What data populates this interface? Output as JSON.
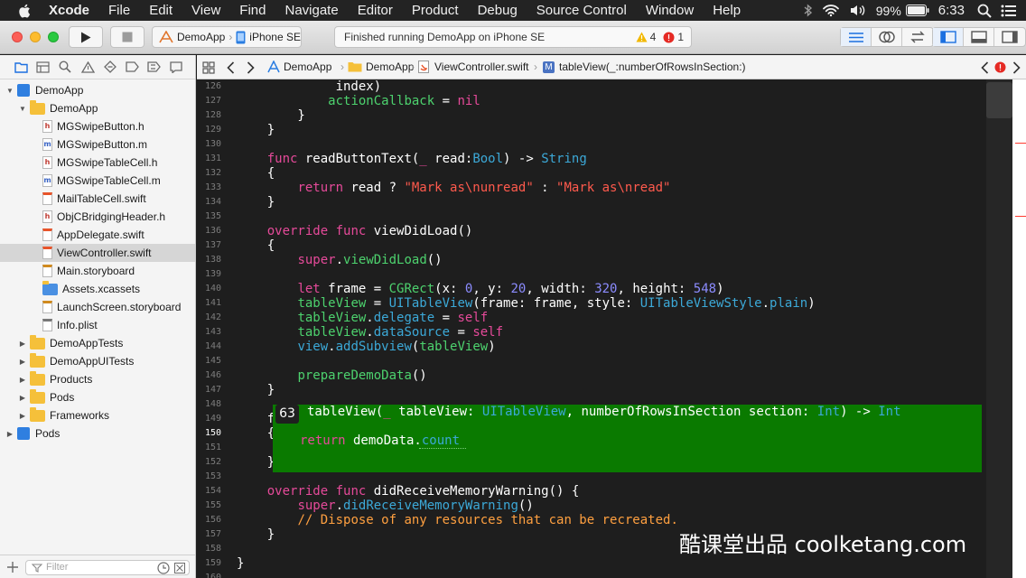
{
  "menubar": {
    "app": "Xcode",
    "items": [
      "File",
      "Edit",
      "View",
      "Find",
      "Navigate",
      "Editor",
      "Product",
      "Debug",
      "Source Control",
      "Window",
      "Help"
    ],
    "battery": "99%",
    "time": "6:33"
  },
  "toolbar": {
    "scheme": "DemoApp",
    "device": "iPhone SE",
    "status": "Finished running DemoApp on iPhone SE",
    "warnings": "4",
    "errors": "1"
  },
  "navigator": {
    "tree": [
      {
        "label": "DemoApp",
        "kind": "project",
        "level": 0,
        "open": true
      },
      {
        "label": "DemoApp",
        "kind": "folder",
        "level": 1,
        "open": true
      },
      {
        "label": "MGSwipeButton.h",
        "kind": "h",
        "level": 2
      },
      {
        "label": "MGSwipeButton.m",
        "kind": "m",
        "level": 2
      },
      {
        "label": "MGSwipeTableCell.h",
        "kind": "h",
        "level": 2
      },
      {
        "label": "MGSwipeTableCell.m",
        "kind": "m",
        "level": 2
      },
      {
        "label": "MailTableCell.swift",
        "kind": "swift",
        "level": 2
      },
      {
        "label": "ObjCBridgingHeader.h",
        "kind": "h",
        "level": 2
      },
      {
        "label": "AppDelegate.swift",
        "kind": "swift",
        "level": 2
      },
      {
        "label": "ViewController.swift",
        "kind": "swift",
        "level": 2,
        "selected": true
      },
      {
        "label": "Main.storyboard",
        "kind": "storyboard",
        "level": 2
      },
      {
        "label": "Assets.xcassets",
        "kind": "assets",
        "level": 2
      },
      {
        "label": "LaunchScreen.storyboard",
        "kind": "storyboard",
        "level": 2
      },
      {
        "label": "Info.plist",
        "kind": "plist",
        "level": 2
      },
      {
        "label": "DemoAppTests",
        "kind": "folder",
        "level": 1,
        "open": false
      },
      {
        "label": "DemoAppUITests",
        "kind": "folder",
        "level": 1,
        "open": false
      },
      {
        "label": "Products",
        "kind": "folder",
        "level": 1,
        "open": false
      },
      {
        "label": "Pods",
        "kind": "folder",
        "level": 1,
        "open": false
      },
      {
        "label": "Frameworks",
        "kind": "folder",
        "level": 1,
        "open": false
      },
      {
        "label": "Pods",
        "kind": "project",
        "level": 0,
        "open": false
      }
    ],
    "filter_placeholder": "Filter"
  },
  "jumpbar": {
    "crumbs": [
      "DemoApp",
      "DemoApp",
      "ViewController.swift",
      "tableView(_:numberOfRowsInSection:)"
    ]
  },
  "editor": {
    "current_line": "150",
    "lines": [
      {
        "n": "126",
        "t": [
          [
            "",
            "             index)"
          ]
        ]
      },
      {
        "n": "127",
        "t": [
          [
            "",
            "            "
          ],
          [
            "fn",
            "actionCallback"
          ],
          [
            "",
            " = "
          ],
          [
            "kw",
            "nil"
          ]
        ]
      },
      {
        "n": "128",
        "t": [
          [
            "",
            "        }"
          ]
        ]
      },
      {
        "n": "129",
        "t": [
          [
            "",
            "    }"
          ]
        ]
      },
      {
        "n": "130",
        "t": [
          [
            "",
            ""
          ]
        ]
      },
      {
        "n": "131",
        "t": [
          [
            "",
            "    "
          ],
          [
            "kw",
            "func"
          ],
          [
            "",
            " readButtonText("
          ],
          [
            "kw",
            "_"
          ],
          [
            "",
            " read:"
          ],
          [
            "ty",
            "Bool"
          ],
          [
            "",
            ") -> "
          ],
          [
            "ty",
            "String"
          ]
        ]
      },
      {
        "n": "132",
        "t": [
          [
            "",
            "    {"
          ]
        ]
      },
      {
        "n": "133",
        "t": [
          [
            "",
            "        "
          ],
          [
            "kw",
            "return"
          ],
          [
            "",
            " read ? "
          ],
          [
            "st",
            "\"Mark as\\nunread\""
          ],
          [
            "",
            " : "
          ],
          [
            "st",
            "\"Mark as\\nread\""
          ]
        ]
      },
      {
        "n": "134",
        "t": [
          [
            "",
            "    }"
          ]
        ]
      },
      {
        "n": "135",
        "t": [
          [
            "",
            ""
          ]
        ]
      },
      {
        "n": "136",
        "t": [
          [
            "",
            "    "
          ],
          [
            "kw",
            "override"
          ],
          [
            "",
            " "
          ],
          [
            "kw",
            "func"
          ],
          [
            "",
            " viewDidLoad()"
          ]
        ]
      },
      {
        "n": "137",
        "t": [
          [
            "",
            "    {"
          ]
        ]
      },
      {
        "n": "138",
        "t": [
          [
            "",
            "        "
          ],
          [
            "kw",
            "super"
          ],
          [
            "",
            "."
          ],
          [
            "fn",
            "viewDidLoad"
          ],
          [
            "",
            "()"
          ]
        ]
      },
      {
        "n": "139",
        "t": [
          [
            "",
            ""
          ]
        ]
      },
      {
        "n": "140",
        "t": [
          [
            "",
            "        "
          ],
          [
            "kw",
            "let"
          ],
          [
            "",
            " frame = "
          ],
          [
            "fn",
            "CGRect"
          ],
          [
            "",
            "(x: "
          ],
          [
            "nm",
            "0"
          ],
          [
            "",
            ", y: "
          ],
          [
            "nm",
            "20"
          ],
          [
            "",
            ", width: "
          ],
          [
            "nm",
            "320"
          ],
          [
            "",
            ", height: "
          ],
          [
            "nm",
            "548"
          ],
          [
            "",
            ")"
          ]
        ]
      },
      {
        "n": "141",
        "t": [
          [
            "",
            "        "
          ],
          [
            "fn",
            "tableView"
          ],
          [
            "",
            " = "
          ],
          [
            "ty",
            "UITableView"
          ],
          [
            "",
            "(frame: frame, style: "
          ],
          [
            "ty",
            "UITableViewStyle"
          ],
          [
            "",
            "."
          ],
          [
            "ty",
            "plain"
          ],
          [
            "",
            ")"
          ]
        ]
      },
      {
        "n": "142",
        "t": [
          [
            "",
            "        "
          ],
          [
            "fn",
            "tableView"
          ],
          [
            "",
            "."
          ],
          [
            "ty",
            "delegate"
          ],
          [
            "",
            " = "
          ],
          [
            "kw",
            "self"
          ]
        ]
      },
      {
        "n": "143",
        "t": [
          [
            "",
            "        "
          ],
          [
            "fn",
            "tableView"
          ],
          [
            "",
            "."
          ],
          [
            "ty",
            "dataSource"
          ],
          [
            "",
            " = "
          ],
          [
            "kw",
            "self"
          ]
        ]
      },
      {
        "n": "144",
        "t": [
          [
            "",
            "        "
          ],
          [
            "ty",
            "view"
          ],
          [
            "",
            "."
          ],
          [
            "ty",
            "addSubview"
          ],
          [
            "",
            "("
          ],
          [
            "fn",
            "tableView"
          ],
          [
            "",
            ")"
          ]
        ]
      },
      {
        "n": "145",
        "t": [
          [
            "",
            ""
          ]
        ]
      },
      {
        "n": "146",
        "t": [
          [
            "",
            "        "
          ],
          [
            "fn",
            "prepareDemoData"
          ],
          [
            "",
            "()"
          ]
        ]
      },
      {
        "n": "147",
        "t": [
          [
            "",
            "    }"
          ]
        ]
      },
      {
        "n": "148",
        "t": [
          [
            "",
            ""
          ]
        ]
      },
      {
        "n": "149",
        "t": [
          [
            "",
            "    f"
          ]
        ]
      },
      {
        "n": "150",
        "t": [
          [
            "",
            "    {"
          ]
        ]
      },
      {
        "n": "151",
        "t": [
          [
            "",
            ""
          ]
        ]
      },
      {
        "n": "152",
        "t": [
          [
            "",
            "    }"
          ]
        ]
      },
      {
        "n": "153",
        "t": [
          [
            "",
            ""
          ]
        ]
      },
      {
        "n": "154",
        "t": [
          [
            "",
            "    "
          ],
          [
            "kw",
            "override"
          ],
          [
            "",
            " "
          ],
          [
            "kw",
            "func"
          ],
          [
            "",
            " didReceiveMemoryWarning() {"
          ]
        ]
      },
      {
        "n": "155",
        "t": [
          [
            "",
            "        "
          ],
          [
            "kw",
            "super"
          ],
          [
            "",
            "."
          ],
          [
            "ty",
            "didReceiveMemoryWarning"
          ],
          [
            "",
            "()"
          ]
        ]
      },
      {
        "n": "156",
        "t": [
          [
            "",
            "        "
          ],
          [
            "cm",
            "// Dispose of any resources that can be recreated."
          ]
        ]
      },
      {
        "n": "157",
        "t": [
          [
            "",
            "    }"
          ]
        ]
      },
      {
        "n": "158",
        "t": [
          [
            "",
            ""
          ]
        ]
      },
      {
        "n": "159",
        "t": [
          [
            "",
            "}"
          ]
        ]
      },
      {
        "n": "160",
        "t": [
          [
            "",
            ""
          ]
        ]
      }
    ],
    "completion": {
      "number": "63",
      "signature": [
        [
          "",
          "tableView("
        ],
        [
          "kw",
          "_"
        ],
        [
          "",
          " tableView: "
        ],
        [
          "ty",
          "UITableView"
        ],
        [
          "",
          ", numberOfRowsInSection section: "
        ],
        [
          "ty",
          "Int"
        ],
        [
          "",
          ") -> "
        ],
        [
          "ty",
          "Int"
        ]
      ],
      "body": [
        [
          "kw",
          "return"
        ],
        [
          "",
          " demoData."
        ],
        [
          "ty",
          "count"
        ]
      ]
    }
  },
  "watermark": "酷课堂出品 coolketang.com",
  "colors": {
    "menubar_bg": "#232323",
    "editor_bg": "#1e1e1e",
    "keyword": "#e64a9a",
    "type": "#3ca9d8",
    "function": "#4dd26e",
    "string": "#ff5a4d",
    "number": "#8c8cff",
    "comment": "#ffa040",
    "completion_bg": "#0a7a00",
    "selected_row": "#d6d6d6",
    "folder": "#f5c03a"
  }
}
